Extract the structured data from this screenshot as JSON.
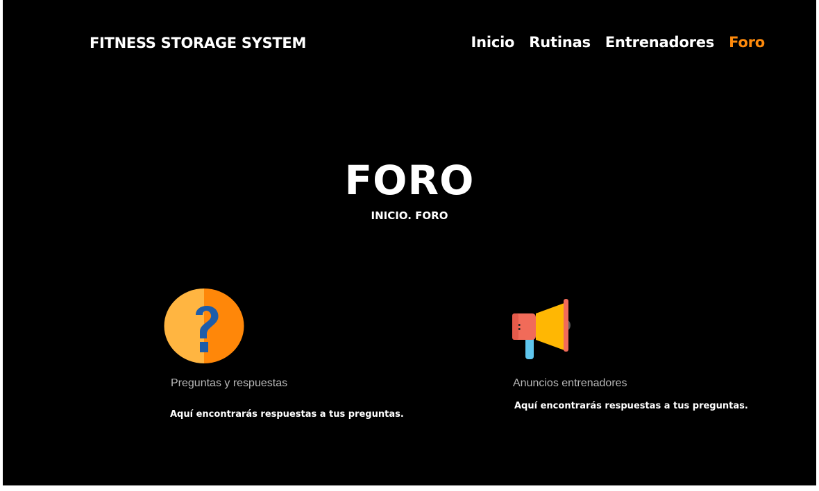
{
  "header": {
    "brand": "FITNESS STORAGE SYSTEM",
    "nav": [
      {
        "label": "Inicio"
      },
      {
        "label": "Rutinas"
      },
      {
        "label": "Entrenadores"
      },
      {
        "label": "Foro"
      }
    ],
    "active_nav": "Foro"
  },
  "hero": {
    "title": "FORO",
    "breadcrumb_home": "INICIO.",
    "breadcrumb_current": "FORO"
  },
  "cards": [
    {
      "icon": "question-mark-icon",
      "title": "Preguntas y respuestas",
      "description": "Aquí encontrarás respuestas a tus preguntas."
    },
    {
      "icon": "megaphone-icon",
      "title": "Anuncios entrenadores",
      "description": "Aquí encontrarás respuestas a tus preguntas."
    }
  ],
  "colors": {
    "background": "#000000",
    "accent": "#fe8a0c",
    "text": "#ffffff",
    "muted_text": "#b8b8b8"
  }
}
